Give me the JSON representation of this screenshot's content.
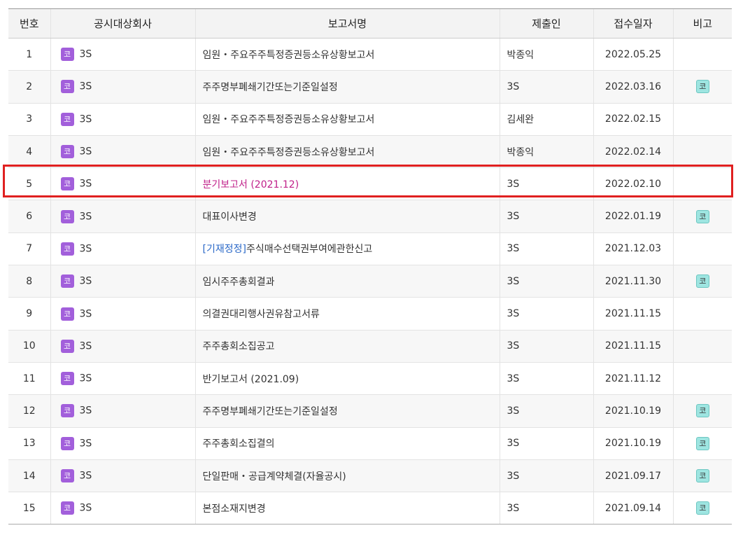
{
  "header": {
    "no": "번호",
    "company": "공시대상회사",
    "report": "보고서명",
    "submitter": "제출인",
    "date": "접수일자",
    "note": "비고"
  },
  "rows": [
    {
      "no": "1",
      "badge": "코",
      "company": "3S",
      "report_prefix": "",
      "report": "임원・주요주주특정증권등소유상황보고서",
      "submitter": "박종익",
      "date": "2022.05.25",
      "note": ""
    },
    {
      "no": "2",
      "badge": "코",
      "company": "3S",
      "report_prefix": "",
      "report": "주주명부폐쇄기간또는기준일설정",
      "submitter": "3S",
      "date": "2022.03.16",
      "note": "코"
    },
    {
      "no": "3",
      "badge": "코",
      "company": "3S",
      "report_prefix": "",
      "report": "임원・주요주주특정증권등소유상황보고서",
      "submitter": "김세완",
      "date": "2022.02.15",
      "note": ""
    },
    {
      "no": "4",
      "badge": "코",
      "company": "3S",
      "report_prefix": "",
      "report": "임원・주요주주특정증권등소유상황보고서",
      "submitter": "박종익",
      "date": "2022.02.14",
      "note": ""
    },
    {
      "no": "5",
      "badge": "코",
      "company": "3S",
      "report_prefix": "",
      "report": "분기보고서 (2021.12)",
      "submitter": "3S",
      "date": "2022.02.10",
      "note": ""
    },
    {
      "no": "6",
      "badge": "코",
      "company": "3S",
      "report_prefix": "",
      "report": "대표이사변경",
      "submitter": "3S",
      "date": "2022.01.19",
      "note": "코"
    },
    {
      "no": "7",
      "badge": "코",
      "company": "3S",
      "report_prefix": "[기재정정]",
      "report": "주식매수선택권부여에관한신고",
      "submitter": "3S",
      "date": "2021.12.03",
      "note": ""
    },
    {
      "no": "8",
      "badge": "코",
      "company": "3S",
      "report_prefix": "",
      "report": "임시주주총회결과",
      "submitter": "3S",
      "date": "2021.11.30",
      "note": "코"
    },
    {
      "no": "9",
      "badge": "코",
      "company": "3S",
      "report_prefix": "",
      "report": "의결권대리행사권유참고서류",
      "submitter": "3S",
      "date": "2021.11.15",
      "note": ""
    },
    {
      "no": "10",
      "badge": "코",
      "company": "3S",
      "report_prefix": "",
      "report": "주주총회소집공고",
      "submitter": "3S",
      "date": "2021.11.15",
      "note": ""
    },
    {
      "no": "11",
      "badge": "코",
      "company": "3S",
      "report_prefix": "",
      "report": "반기보고서 (2021.09)",
      "submitter": "3S",
      "date": "2021.11.12",
      "note": ""
    },
    {
      "no": "12",
      "badge": "코",
      "company": "3S",
      "report_prefix": "",
      "report": "주주명부폐쇄기간또는기준일설정",
      "submitter": "3S",
      "date": "2021.10.19",
      "note": "코"
    },
    {
      "no": "13",
      "badge": "코",
      "company": "3S",
      "report_prefix": "",
      "report": "주주총회소집결의",
      "submitter": "3S",
      "date": "2021.10.19",
      "note": "코"
    },
    {
      "no": "14",
      "badge": "코",
      "company": "3S",
      "report_prefix": "",
      "report": "단일판매・공급계약체결(자율공시)",
      "submitter": "3S",
      "date": "2021.09.17",
      "note": "코"
    },
    {
      "no": "15",
      "badge": "코",
      "company": "3S",
      "report_prefix": "",
      "report": "본점소재지변경",
      "submitter": "3S",
      "date": "2021.09.14",
      "note": "코"
    }
  ],
  "highlighted_row": "5",
  "colors": {
    "market_badge": "#a25fdb",
    "note_badge": "#9ee5e1",
    "highlight_border": "#e02020",
    "highlight_link": "#c0208a",
    "prefix_link": "#2b69c8"
  }
}
